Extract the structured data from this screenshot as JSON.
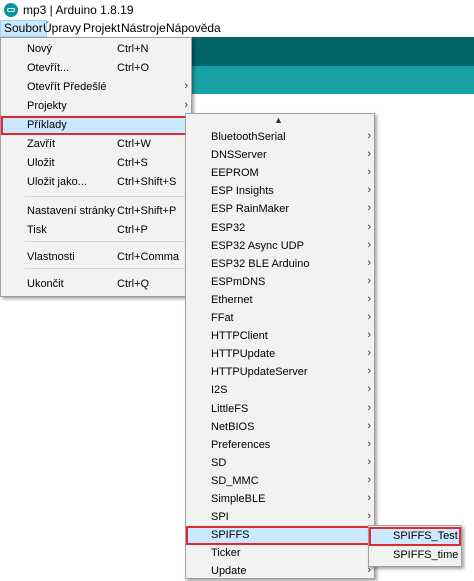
{
  "window": {
    "title": "mp3 | Arduino 1.8.19"
  },
  "menubar": [
    "Soubor",
    "Úpravy",
    "Projekt",
    "Nástroje",
    "Nápověda"
  ],
  "file_menu": [
    {
      "label": "Nový",
      "shortcut": "Ctrl+N"
    },
    {
      "label": "Otevřít...",
      "shortcut": "Ctrl+O"
    },
    {
      "label": "Otevřít Předešlé",
      "shortcut": "",
      "submenu": true
    },
    {
      "label": "Projekty",
      "shortcut": "",
      "submenu": true
    },
    {
      "label": "Příklady",
      "shortcut": "",
      "submenu": true,
      "active": true
    },
    {
      "label": "Zavřít",
      "shortcut": "Ctrl+W"
    },
    {
      "label": "Uložit",
      "shortcut": "Ctrl+S"
    },
    {
      "label": "Uložit jako...",
      "shortcut": "Ctrl+Shift+S"
    },
    {
      "label": "Nastavení stránky",
      "shortcut": "Ctrl+Shift+P"
    },
    {
      "label": "Tisk",
      "shortcut": "Ctrl+P"
    },
    {
      "label": "Vlastnosti",
      "shortcut": "Ctrl+Comma"
    },
    {
      "label": "Ukončit",
      "shortcut": "Ctrl+Q"
    }
  ],
  "examples_menu": {
    "scroll_up_glyph": "▲",
    "items": [
      "BluetoothSerial",
      "DNSServer",
      "EEPROM",
      "ESP Insights",
      "ESP RainMaker",
      "ESP32",
      "ESP32 Async UDP",
      "ESP32 BLE Arduino",
      "ESPmDNS",
      "Ethernet",
      "FFat",
      "HTTPClient",
      "HTTPUpdate",
      "HTTPUpdateServer",
      "I2S",
      "LittleFS",
      "NetBIOS",
      "Preferences",
      "SD",
      "SD_MMC",
      "SimpleBLE",
      "SPI",
      "SPIFFS",
      "Ticker",
      "Update"
    ],
    "active": "SPIFFS"
  },
  "spiffs_menu": {
    "items": [
      "SPIFFS_Test",
      "SPIFFS_time"
    ],
    "active": "SPIFFS_Test"
  },
  "colors": {
    "toolbar": "#006468",
    "tabbar": "#17a1a5",
    "highlight_outline": "#e0282e",
    "menu_bg": "#f2f2f2"
  }
}
